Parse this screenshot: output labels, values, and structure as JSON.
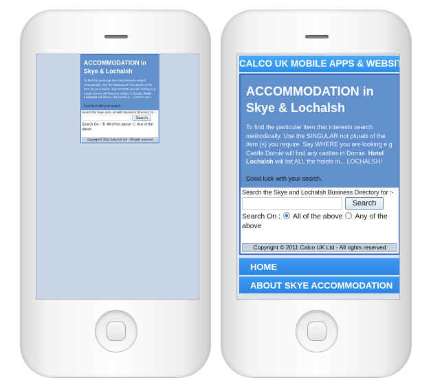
{
  "header": {
    "title": "CALCO UK MOBILE APPS & WEBSITES"
  },
  "main": {
    "heading": "ACCOMMODATION in Skye & Lochalsh",
    "intro_1": "To find the particular item that interests search methodically. Use the SINGULAR not plurals of the item (s) you require. Say WHERE you are looking e.g Castle Dornie will find any castles in Dornie. ",
    "intro_bold": "Hotel Lochalsh",
    "intro_2": " will list ALL the hotels in... LOCHALSH!",
    "luck": "Good luck with your search."
  },
  "search": {
    "label": "Search the Skye and Lochalsh Business Directory for :-",
    "value": "",
    "button": "Search",
    "search_on": "Search On :",
    "option_all": "All of the above",
    "option_any": "Any of the above",
    "selected": "All of the above"
  },
  "footer": {
    "copyright": "Copyright © 2011 Calco UK Ltd - All rights reserved"
  },
  "nav": [
    {
      "label": "HOME"
    },
    {
      "label": "ABOUT SKYE ACCOMMODATION"
    }
  ],
  "colors": {
    "header": "#2c8fe8",
    "content": "#6190cc",
    "screen_bg": "#c9d6e8"
  }
}
